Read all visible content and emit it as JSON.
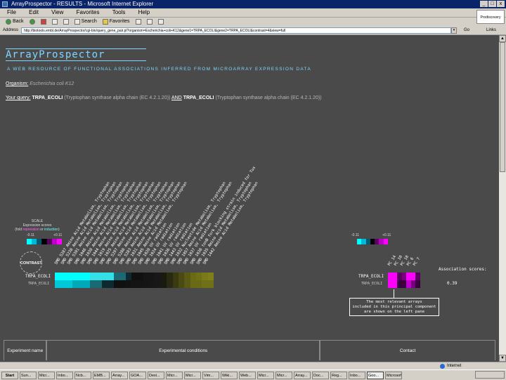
{
  "window": {
    "title": "ArrayProspector - RESULTS - Microsoft Internet Explorer",
    "controls": [
      "_",
      "□",
      "x"
    ]
  },
  "menu": [
    "File",
    "Edit",
    "View",
    "Favorites",
    "Tools",
    "Help"
  ],
  "throbber_text": "Prodiscovery",
  "toolbar": {
    "back": "Back",
    "search": "Search",
    "favorites": "Favorites",
    "history": "History"
  },
  "address": {
    "label": "Address",
    "url": "http://biotools.embl.de/ArrayProspector/cgi-bin/query_gene_pair.pl?organism=Escherichia+coli+K12&gene1=TRPA_ECOLI&gene2=TRPA_ECOLI&contrast=4&view=full",
    "go": "Go",
    "links": "Links"
  },
  "page": {
    "brand": "ArrayProspector",
    "tagline": "A WEB RESOURCE OF FUNCTIONAL ASSOCIATIONS INFERRED FROM MICROARRAY EXPRESSION DATA",
    "organism_label": "Organism:",
    "organism_value": "Escherichia coli K12",
    "query_label": "Your query:",
    "query_gene1": "TRPA_ECOLI",
    "query_gene1_desc": "(Tryptophan synthase alpha chain (EC 4.2.1.20))",
    "query_and": "AND",
    "query_gene2": "TRPA_ECOLI",
    "query_gene2_desc": "(Tryptophan synthase alpha chain (EC 4.2.1.20))"
  },
  "scale": {
    "title": "SCALE",
    "subtitle": "Expression scores",
    "legend_prefix": "(fold ",
    "legend_repression": "repression",
    "legend_or": " or ",
    "legend_induction": "induction",
    "legend_suffix": ")",
    "left_min": "-0.11",
    "left_max": "+0.11",
    "right_min": "-0.11",
    "right_max": "+0.11",
    "colors": [
      "#00ffff",
      "#00b8d8",
      "#005a70",
      "#000000",
      "#5a0060",
      "#b800c8",
      "#ff00ff"
    ]
  },
  "contrast_label": "CONTRAST",
  "rows": {
    "top": "TRPA_ECOLI",
    "bottom": "TRPA_ECOLI"
  },
  "left_conditions": [
    "SMD 5287 Amino Acid Metabolism, Tryptophan",
    "SMD 5238 Amino Acid Metabolism, Tryptophan",
    "SMD 5301 Amino Acid Metabolism, Tryptophan",
    "SMD 1046 Amino Acid Metabolism, Tryptophan",
    "SMD 1030 Amino Acid Metabolism, Tryptophan",
    "SMD 1044 Amino Acid Metabolism, Tryptophan",
    "SMD 1019 Amino Acid Metabolism, Tryptophan",
    "SMD 1025 Amino Acid Metabolism, Tryptophan",
    "SMD 5297 Amino Acid Metabolism, Tryptophan",
    "SMD 5288 Amino Acid Metabolism, Tryptophan",
    "SMD 5283 Amino Acid Metabolism, Tryptophan",
    "SMD 1031 Amino Acid Metabolism, Tryptophan",
    "SMD 1045 Amino Acid Metabolism, Tryptophan",
    "SMD 1020 UV radiation",
    "SMD 1024 UV radiation",
    "SMD 1041 UV radiation",
    "SMD 1036 UV radiation",
    "SMD 1443 UV radiation",
    "SMD 1032 Nucleotide Metabolism, Tryptophan",
    "SMD 1057 Amino Acid Metabolism, Tryptophan",
    "SMD 1037 UV radiation",
    "SMD 1038 tonB fork blocking strain induced for Tus",
    "SMD 1035 Amino Acid Metabolism, Tryptophan",
    "SMD 1442 Amino Acid Metabolism, Tryptophan"
  ],
  "left_heat_top": [
    "#00ffff",
    "#00ffff",
    "#00ffff",
    "#00ffff",
    "#00ffff",
    "#00ffff",
    "#33e0e8",
    "#33e0e8",
    "#33e0e8",
    "#33e0e8",
    "#1a6a75",
    "#1a6a75",
    "#0d2a30",
    "#101010",
    "#101010",
    "#151515",
    "#151515",
    "#181818",
    "#1a1a10",
    "#2a2a10",
    "#3a3a10",
    "#4a4a12",
    "#5a5a12",
    "#6a6a14",
    "#707014",
    "#7a7a18",
    "#808018"
  ],
  "left_heat_bottom": [
    "#00c8d8",
    "#00c8d8",
    "#00c8d8",
    "#00a8b8",
    "#00a8b8",
    "#00a8b8",
    "#1a6a75",
    "#1a6a75",
    "#0d2a30",
    "#0d2a30",
    "#101010",
    "#101010",
    "#121212",
    "#141414",
    "#141414",
    "#151515",
    "#161616",
    "#181818",
    "#1a1a12",
    "#2a2a12",
    "#3a3a12",
    "#4a4a14",
    "#5a5a14",
    "#6a6a16",
    "#6a6a16",
    "#707018",
    "#707018"
  ],
  "right_conditions": [
    "PC 14",
    "PC 10",
    "PC 18",
    "PC 6",
    "PC 7"
  ],
  "right_heat_top": [
    "#ff00ff",
    "#ff00ff",
    "#5a0060",
    "#7a0080",
    "#ff00ff",
    "#ff00ff",
    "#5a0060"
  ],
  "right_heat_bottom": [
    "#ff00ff",
    "#ff00ff",
    "#3a0040",
    "#3a0040",
    "#c000d0",
    "#7a0080",
    "#3a0040"
  ],
  "association": {
    "title": "Association scores:",
    "value": "0.39"
  },
  "tip": {
    "line1": "The most relevant arrays",
    "line2": "included in this principal component",
    "line3": "are shown on the left pane"
  },
  "bottom_table": {
    "col1": "Experiment name",
    "col2": "Experimental conditions",
    "col3": "Contact"
  },
  "status": {
    "zone": "Internet"
  },
  "taskbar": {
    "start": "Start",
    "tasks": [
      "Sun...",
      "Micr...",
      "Inbo...",
      "Ncb...",
      "EMB...",
      "Array...",
      "GOA...",
      "Dexi...",
      "Micr...",
      "Micr...",
      "Vim...",
      "Wiki...",
      "Web...",
      "Micr...",
      "Micr...",
      "Array...",
      "Doc...",
      "Reg...",
      "Inbo...",
      "Goo...",
      "Microsoft..."
    ],
    "active_index": 19,
    "clock": ""
  }
}
